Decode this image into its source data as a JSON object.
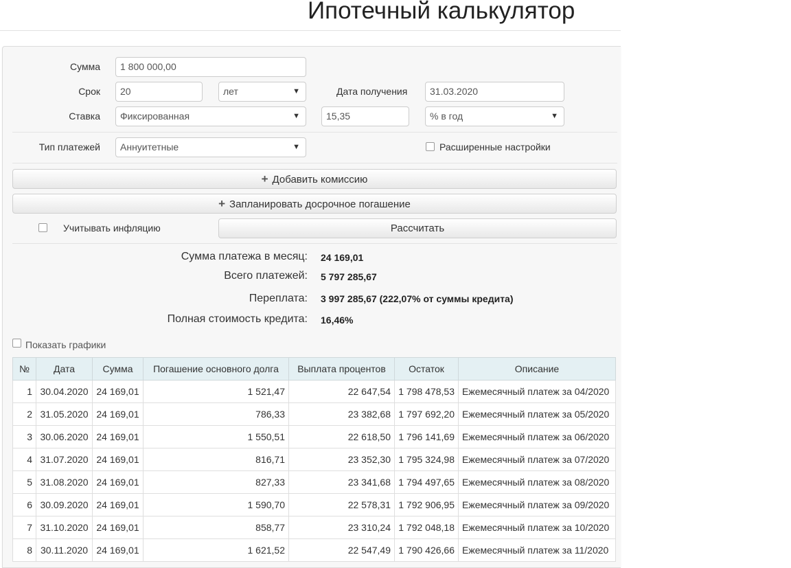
{
  "page": {
    "title": "Ипотечный калькулятор"
  },
  "form": {
    "amount_label": "Сумма",
    "amount_value": "1 800 000,00",
    "term_label": "Срок",
    "term_value": "20",
    "term_unit": "лет",
    "date_label": "Дата получения",
    "date_value": "31.03.2020",
    "rate_label": "Ставка",
    "rate_type": "Фиксированная",
    "rate_value": "15,35",
    "rate_unit": "% в год",
    "payment_type_label": "Тип платежей",
    "payment_type_value": "Аннуитетные",
    "advanced_label": "Расширенные настройки",
    "add_commission": "Добавить комиссию",
    "plan_early_repayment": "Запланировать досрочное погашение",
    "inflation_label": "Учитывать инфляцию",
    "calculate": "Рассчитать"
  },
  "summary": {
    "monthly_label": "Сумма платежа в месяц:",
    "monthly_value": "24 169,01",
    "total_label": "Всего платежей:",
    "total_value": "5 797 285,67",
    "overpay_label": "Переплата:",
    "overpay_value": "3 997 285,67 (222,07% от суммы кредита)",
    "full_cost_label": "Полная стоимость кредита:",
    "full_cost_value": "16,46%"
  },
  "show_charts_label": "Показать графики",
  "table": {
    "headers": [
      "№",
      "Дата",
      "Сумма",
      "Погашение основного долга",
      "Выплата процентов",
      "Остаток",
      "Описание"
    ],
    "rows": [
      [
        "1",
        "30.04.2020",
        "24 169,01",
        "1 521,47",
        "22 647,54",
        "1 798 478,53",
        "Ежемесячный платеж за 04/2020"
      ],
      [
        "2",
        "31.05.2020",
        "24 169,01",
        "786,33",
        "23 382,68",
        "1 797 692,20",
        "Ежемесячный платеж за 05/2020"
      ],
      [
        "3",
        "30.06.2020",
        "24 169,01",
        "1 550,51",
        "22 618,50",
        "1 796 141,69",
        "Ежемесячный платеж за 06/2020"
      ],
      [
        "4",
        "31.07.2020",
        "24 169,01",
        "816,71",
        "23 352,30",
        "1 795 324,98",
        "Ежемесячный платеж за 07/2020"
      ],
      [
        "5",
        "31.08.2020",
        "24 169,01",
        "827,33",
        "23 341,68",
        "1 794 497,65",
        "Ежемесячный платеж за 08/2020"
      ],
      [
        "6",
        "30.09.2020",
        "24 169,01",
        "1 590,70",
        "22 578,31",
        "1 792 906,95",
        "Ежемесячный платеж за 09/2020"
      ],
      [
        "7",
        "31.10.2020",
        "24 169,01",
        "858,77",
        "23 310,24",
        "1 792 048,18",
        "Ежемесячный платеж за 10/2020"
      ],
      [
        "8",
        "30.11.2020",
        "24 169,01",
        "1 621,52",
        "22 547,49",
        "1 790 426,66",
        "Ежемесячный платеж за 11/2020"
      ]
    ]
  }
}
